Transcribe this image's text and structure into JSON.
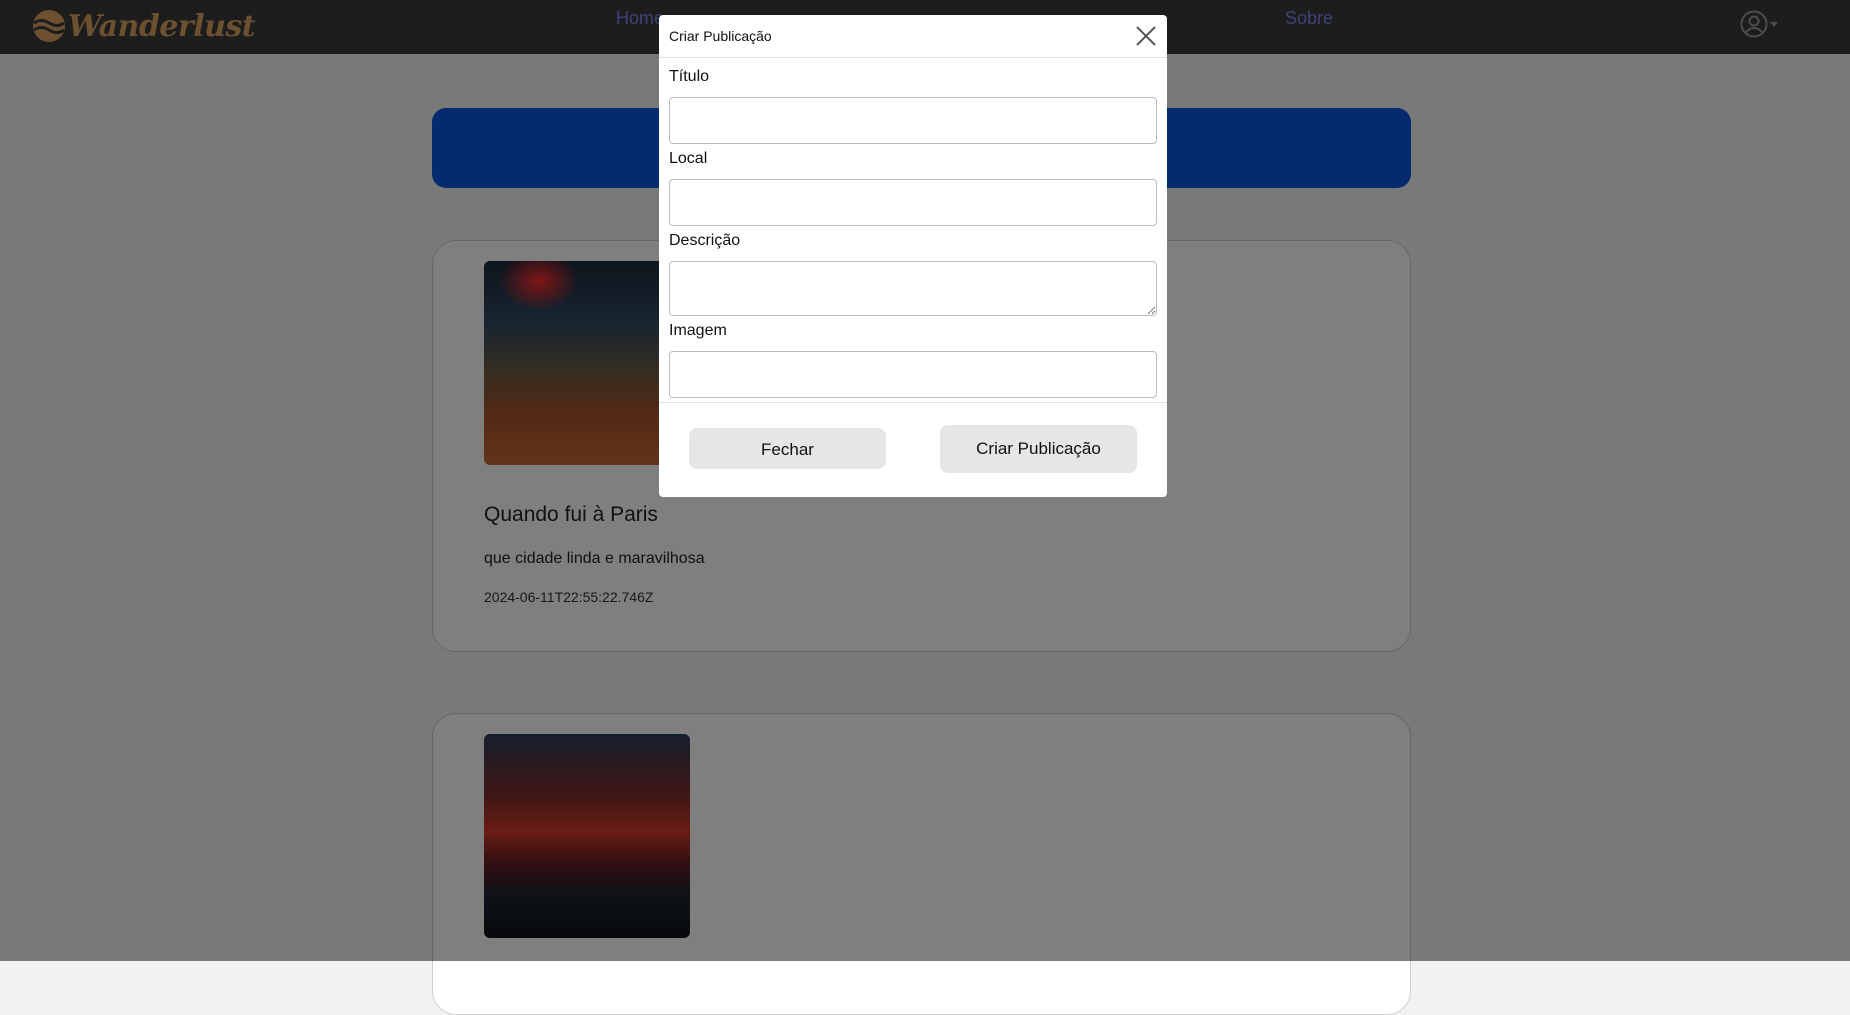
{
  "brand": {
    "name": "Wanderlust",
    "color": "#d9a15e"
  },
  "nav": {
    "links": [
      {
        "label": "Home"
      },
      {
        "label": "Sobre"
      }
    ],
    "user_icon": "user-circle-icon",
    "dropdown_icon": "caret-down-icon"
  },
  "banner": {
    "color": "#0a55e0"
  },
  "posts": [
    {
      "title": "Quando fui à Paris",
      "description": "que cidade linda e maravilhosa",
      "date": "2024-06-11T22:55:22.746Z"
    },
    {
      "title": "",
      "description": "",
      "date": ""
    }
  ],
  "modal": {
    "title": "Criar Publicação",
    "close_icon": "close-x-icon",
    "fields": {
      "titulo": {
        "label": "Título",
        "value": ""
      },
      "local": {
        "label": "Local",
        "value": ""
      },
      "descricao": {
        "label": "Descrição",
        "value": ""
      },
      "imagem": {
        "label": "Imagem",
        "value": ""
      }
    },
    "buttons": {
      "close_label": "Fechar",
      "create_label": "Criar Publicação"
    }
  }
}
